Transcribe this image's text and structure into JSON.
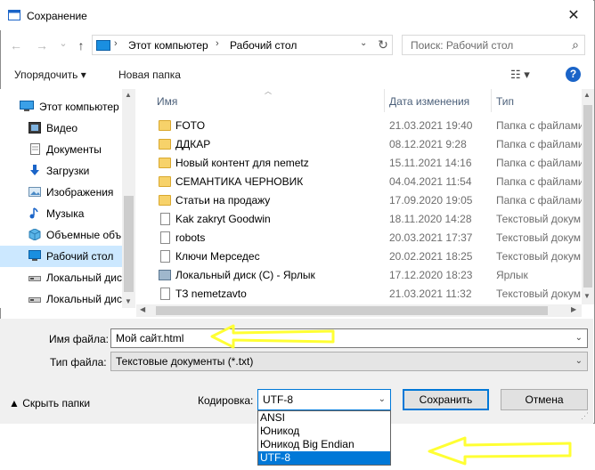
{
  "window": {
    "title": "Сохранение",
    "close_glyph": "✕"
  },
  "nav": {
    "back_glyph": "←",
    "forward_glyph": "→",
    "recent_glyph": "⌄",
    "up_glyph": "↑",
    "breadcrumbs": [
      "Этот компьютер",
      "Рабочий стол"
    ],
    "sep_glyph": "›",
    "refresh_glyph": "↻",
    "search_placeholder": "Поиск: Рабочий стол",
    "search_glyph": "⌕"
  },
  "toolbar": {
    "organize": "Упорядочить ▾",
    "new_folder": "Новая папка",
    "view_glyph": "☷ ▾",
    "help": "?"
  },
  "sidebar": {
    "items": [
      {
        "label": "Этот компьютер",
        "icon": "computer-icon"
      },
      {
        "label": "Видео",
        "icon": "video-icon"
      },
      {
        "label": "Документы",
        "icon": "documents-icon"
      },
      {
        "label": "Загрузки",
        "icon": "downloads-icon"
      },
      {
        "label": "Изображения",
        "icon": "pictures-icon"
      },
      {
        "label": "Музыка",
        "icon": "music-icon"
      },
      {
        "label": "Объемные объ",
        "icon": "3d-objects-icon"
      },
      {
        "label": "Рабочий стол",
        "icon": "desktop-icon"
      },
      {
        "label": "Локальный диск",
        "icon": "disk-icon"
      },
      {
        "label": "Локальный диск",
        "icon": "disk-icon"
      }
    ],
    "selected_index": 7
  },
  "files": {
    "columns": {
      "name": "Имя",
      "date": "Дата изменения",
      "type": "Тип"
    },
    "rows": [
      {
        "name": "FOTO",
        "date": "21.03.2021 19:40",
        "type": "Папка с файлами",
        "kind": "folder"
      },
      {
        "name": "ДДКАР",
        "date": "08.12.2021 9:28",
        "type": "Папка с файлами",
        "kind": "folder"
      },
      {
        "name": "Новый контент для nemetz",
        "date": "15.11.2021 14:16",
        "type": "Папка с файлами",
        "kind": "folder"
      },
      {
        "name": "СЕМАНТИКА ЧЕРНОВИК",
        "date": "04.04.2021 11:54",
        "type": "Папка с файлами",
        "kind": "folder"
      },
      {
        "name": "Статьи на продажу",
        "date": "17.09.2020 19:05",
        "type": "Папка с файлами",
        "kind": "folder"
      },
      {
        "name": "Kak zakryt Goodwin",
        "date": "18.11.2020 14:28",
        "type": "Текстовый докум",
        "kind": "doc"
      },
      {
        "name": "robots",
        "date": "20.03.2021 17:37",
        "type": "Текстовый докум",
        "kind": "doc"
      },
      {
        "name": "Ключи Мерседес",
        "date": "20.02.2021 18:25",
        "type": "Текстовый докум",
        "kind": "doc"
      },
      {
        "name": "Локальный диск (C) - Ярлык",
        "date": "17.12.2020 18:23",
        "type": "Ярлык",
        "kind": "shortcut"
      },
      {
        "name": "ТЗ nemetzavto",
        "date": "21.03.2021 11:32",
        "type": "Текстовый докум",
        "kind": "doc"
      }
    ]
  },
  "form": {
    "filename_label": "Имя файла:",
    "filename_value": "Мой сайт.html",
    "filetype_label": "Тип файла:",
    "filetype_value": "Текстовые документы (*.txt)",
    "hide_folders": "▲ Скрыть папки",
    "encoding_label": "Кодировка:",
    "encoding_value": "UTF-8",
    "encoding_options": [
      "ANSI",
      "Юникод",
      "Юникод Big Endian",
      "UTF-8"
    ],
    "encoding_selected_index": 3,
    "save_button": "Сохранить",
    "cancel_button": "Отмена",
    "dropdown_glyph": "⌄"
  },
  "colors": {
    "accent": "#0078d7",
    "selection": "#cce8ff",
    "annotation_arrow": "#ffff33"
  }
}
